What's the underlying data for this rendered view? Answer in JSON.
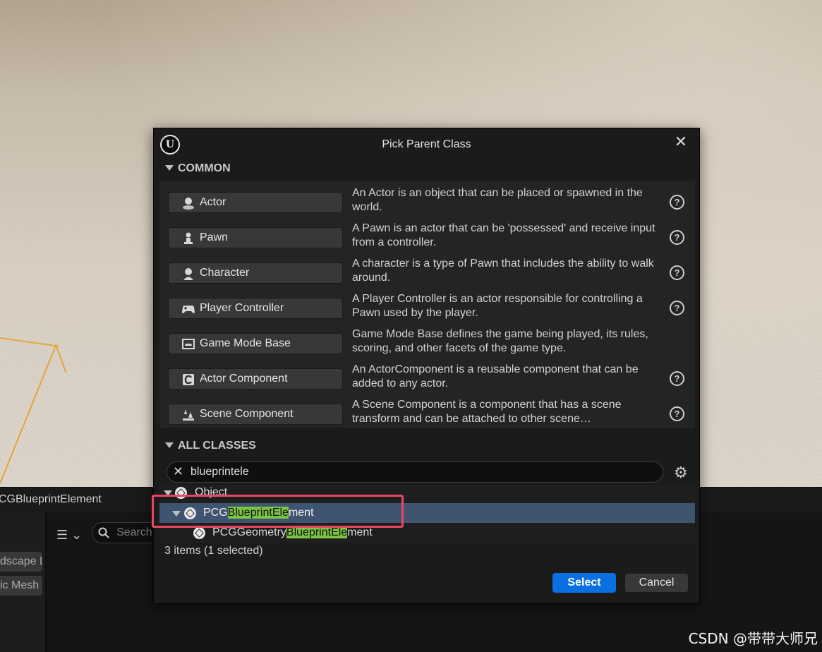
{
  "background": {
    "tab_label": "CGBlueprintElement",
    "chips": [
      "dscape L",
      "ic Mesh"
    ],
    "search_placeholder": "Search",
    "watermark": "CSDN @带带大师兄"
  },
  "dialog": {
    "title": "Pick Parent Class",
    "common_header": "COMMON",
    "common": [
      {
        "label": "Actor",
        "desc": "An Actor is an object that can be placed or spawned in the world.",
        "icon": "actor-icon",
        "help": true
      },
      {
        "label": "Pawn",
        "desc": "A Pawn is an actor that can be 'possessed' and receive input from a controller.",
        "icon": "pawn-icon",
        "help": true
      },
      {
        "label": "Character",
        "desc": "A character is a type of Pawn that includes the ability to walk around.",
        "icon": "character-icon",
        "help": true
      },
      {
        "label": "Player Controller",
        "desc": "A Player Controller is an actor responsible for controlling a Pawn used by the player.",
        "icon": "gamepad-icon",
        "help": true
      },
      {
        "label": "Game Mode Base",
        "desc": "Game Mode Base defines the game being played, its rules, scoring, and other facets of the game type.",
        "icon": "game-mode-icon",
        "help": false
      },
      {
        "label": "Actor Component",
        "desc": "An ActorComponent is a reusable component that can be added to any actor.",
        "icon": "component-icon",
        "help": true
      },
      {
        "label": "Scene Component",
        "desc": "A Scene Component is a component that has a scene transform and can be attached to other scene…",
        "icon": "scene-component-icon",
        "help": true
      }
    ],
    "all_classes_header": "ALL CLASSES",
    "search_value": "blueprintele",
    "tree": [
      {
        "pre": "Object",
        "match": "",
        "post": ""
      },
      {
        "pre": "PCG",
        "match": "BlueprintEle",
        "post": "ment"
      },
      {
        "pre": "PCGGeometry",
        "match": "BlueprintEle",
        "post": "ment"
      }
    ],
    "status": "3 items (1 selected)",
    "select_label": "Select",
    "cancel_label": "Cancel"
  },
  "colors": {
    "select_button": "#0a6fe0",
    "selected_row": "#3f5470",
    "match_highlight": "#7bc443",
    "annotation_box": "#ea4763"
  }
}
